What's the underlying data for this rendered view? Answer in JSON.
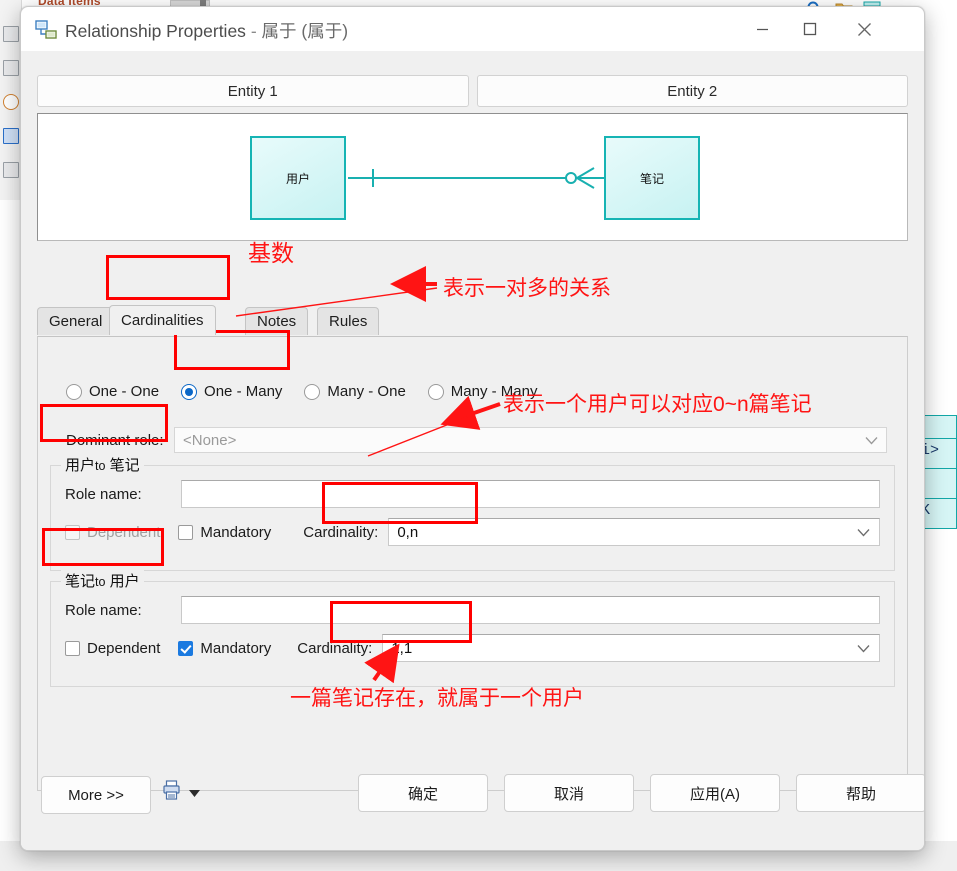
{
  "background": {
    "panel_title": "Data Items",
    "entity_rows": [
      "",
      "<pi>",
      "",
      "_PK"
    ],
    "palette_icon_names": [
      "entity-tool",
      "relationship-tool",
      "inheritance-tool",
      "association-tool",
      "link-tool"
    ]
  },
  "window": {
    "title_main": "Relationship Properties",
    "title_sep": "-",
    "title_sub": "属于 (属于)",
    "icon": "relationship-icon",
    "minimize_label": "—",
    "maximize_label": "□",
    "close_label": "✕"
  },
  "entity_tabs": [
    {
      "label": "Entity 1",
      "name": "entity-1-button"
    },
    {
      "label": "Entity 2",
      "name": "entity-2-button"
    }
  ],
  "preview": {
    "left_entity": "用户",
    "right_entity": "笔记",
    "link_type": "one-to-many",
    "entity_border_color": "#16b4b4",
    "entity_fill_color": "#c7f2f2"
  },
  "tabs": [
    {
      "label": "General",
      "active": false
    },
    {
      "label": "Cardinalities",
      "active": true
    },
    {
      "label": "Notes",
      "active": false
    },
    {
      "label": "Rules",
      "active": false
    }
  ],
  "cardinality_options": [
    {
      "label": "One - One",
      "selected": false
    },
    {
      "label": "One - Many",
      "selected": true
    },
    {
      "label": "Many - One",
      "selected": false
    },
    {
      "label": "Many - Many",
      "selected": false
    }
  ],
  "dominant_role": {
    "label": "Dominant role:",
    "value": "<None>"
  },
  "groups": [
    {
      "legend_left": "用户",
      "legend_mid": "to",
      "legend_right": "笔记",
      "role_name_label": "Role name:",
      "role_name_value": "",
      "dependent_label": "Dependent",
      "dependent_checked": false,
      "dependent_disabled": true,
      "mandatory_label": "Mandatory",
      "mandatory_checked": false,
      "cardinality_label": "Cardinality:",
      "cardinality_value": "0,n"
    },
    {
      "legend_left": "笔记",
      "legend_mid": "to",
      "legend_right": "用户",
      "role_name_label": "Role name:",
      "role_name_value": "",
      "dependent_label": "Dependent",
      "dependent_checked": false,
      "dependent_disabled": false,
      "mandatory_label": "Mandatory",
      "mandatory_checked": true,
      "cardinality_label": "Cardinality:",
      "cardinality_value": "1,1"
    }
  ],
  "footer": {
    "more_label": "More >>",
    "print_icon": "print-icon",
    "dropdown_icon": "caret-down-icon",
    "ok_label": "确定",
    "cancel_label": "取消",
    "apply_label": "应用(A)",
    "help_label": "帮助"
  },
  "annotations": {
    "color": "#ff1414",
    "jishu": "基数",
    "one_to_many": "表示一对多的关系",
    "zero_to_n": "表示一个用户可以对应0~n篇笔记",
    "bottom_note": "一篇笔记存在，就属于一个用户"
  }
}
